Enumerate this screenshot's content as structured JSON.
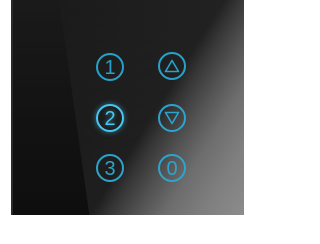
{
  "keypad": {
    "accent_color": "#1f9ec9",
    "active_color": "#3cc6f2",
    "panel_color": "#141414",
    "active_key": "2",
    "keys": [
      {
        "label": "1"
      },
      {
        "label": "2"
      },
      {
        "label": "3"
      },
      {
        "label": "",
        "icon": "up-triangle-icon"
      },
      {
        "label": "",
        "icon": "down-triangle-icon"
      },
      {
        "label": "0"
      }
    ]
  }
}
